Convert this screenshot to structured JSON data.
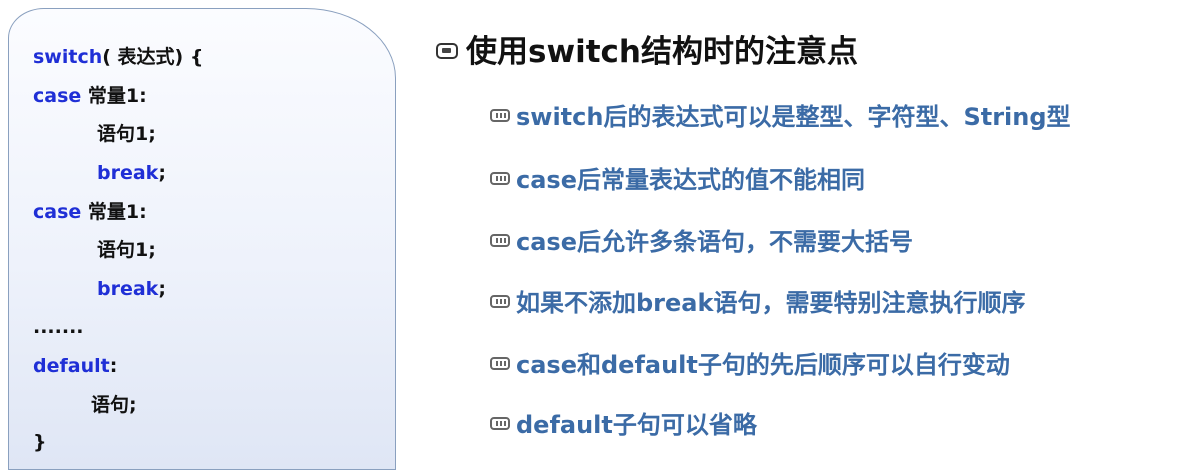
{
  "code": {
    "lines": [
      {
        "kw": "switch",
        "rest": "( 表达式) {"
      },
      {
        "kw": "case",
        "rest": " 常量1:"
      },
      {
        "kw": "",
        "rest": "语句1;"
      },
      {
        "kw": "break",
        "rest": ";"
      },
      {
        "kw": "case",
        "rest": " 常量1:"
      },
      {
        "kw": "",
        "rest": "语句1;"
      },
      {
        "kw": "break",
        "rest": ";"
      },
      {
        "kw": "",
        "rest": "......."
      },
      {
        "kw": "default",
        "rest": ":"
      },
      {
        "kw": "",
        "rest": "语句;"
      },
      {
        "kw": "",
        "rest": "}"
      }
    ]
  },
  "notes": {
    "title": "使用switch结构时的注意点",
    "points": [
      "switch后的表达式可以是整型、字符型、String型",
      "case后常量表达式的值不能相同",
      "case后允许多条语句，不需要大括号",
      "如果不添加break语句，需要特别注意执行顺序",
      "case和default子句的先后顺序可以自行变动",
      "default子句可以省略"
    ]
  }
}
